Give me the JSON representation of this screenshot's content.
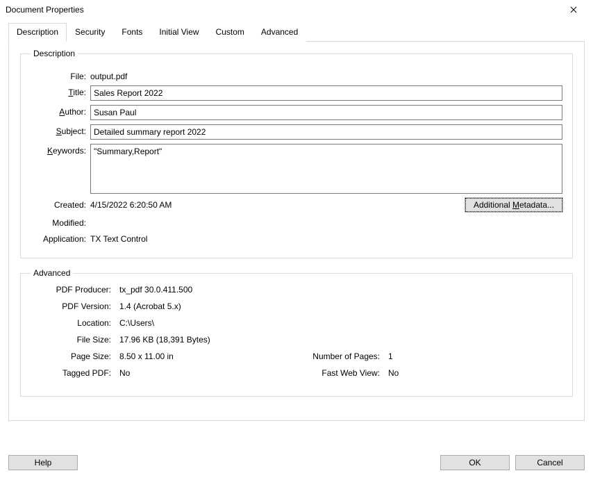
{
  "window": {
    "title": "Document Properties"
  },
  "tabs": {
    "description": "Description",
    "security": "Security",
    "fonts": "Fonts",
    "initial_view": "Initial View",
    "custom": "Custom",
    "advanced": "Advanced"
  },
  "group_description": {
    "legend": "Description",
    "file_label": "File:",
    "file_value": "output.pdf",
    "title_label": "Title:",
    "title_value": "Sales Report 2022",
    "author_label": "Author:",
    "author_value": "Susan Paul",
    "subject_label": "Subject:",
    "subject_value": "Detailed summary report 2022",
    "keywords_label": "Keywords:",
    "keywords_value": "\"Summary,Report\"",
    "created_label": "Created:",
    "created_value": "4/15/2022 6:20:50 AM",
    "modified_label": "Modified:",
    "modified_value": "",
    "application_label": "Application:",
    "application_value": "TX Text Control",
    "additional_metadata_btn": "Additional Metadata..."
  },
  "group_advanced": {
    "legend": "Advanced",
    "pdf_producer_label": "PDF Producer:",
    "pdf_producer_value": "tx_pdf 30.0.411.500",
    "pdf_version_label": "PDF Version:",
    "pdf_version_value": "1.4 (Acrobat 5.x)",
    "location_label": "Location:",
    "location_value": "C:\\Users\\",
    "file_size_label": "File Size:",
    "file_size_value": "17.96 KB (18,391 Bytes)",
    "page_size_label": "Page Size:",
    "page_size_value": "8.50 x 11.00 in",
    "num_pages_label": "Number of Pages:",
    "num_pages_value": "1",
    "tagged_pdf_label": "Tagged PDF:",
    "tagged_pdf_value": "No",
    "fast_web_label": "Fast Web View:",
    "fast_web_value": "No"
  },
  "footer": {
    "help": "Help",
    "ok": "OK",
    "cancel": "Cancel"
  }
}
